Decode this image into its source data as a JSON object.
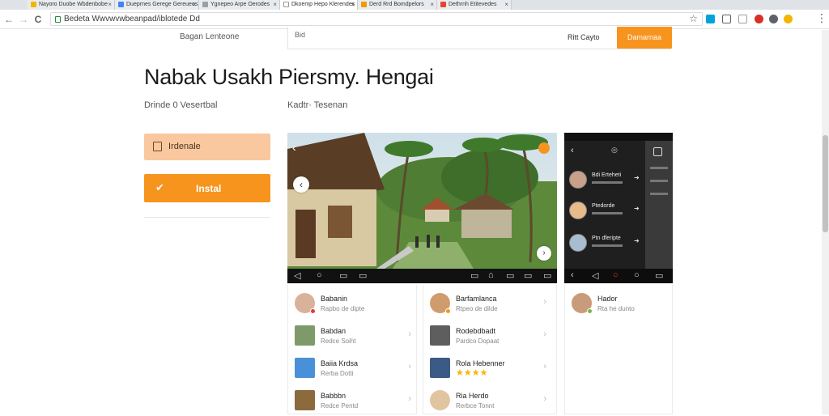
{
  "browser": {
    "tabs": [
      {
        "label": "Nayoro Duobe Wbdenbobe",
        "favicon_color": "#f4b400",
        "active": false
      },
      {
        "label": "Dueprnes Gerege Gereueos",
        "favicon_color": "#4285f4",
        "active": false
      },
      {
        "label": "Ygnepeo Arpe Oerodes",
        "favicon_color": "#9aa0a6",
        "active": false
      },
      {
        "label": "Dkoemp Hepo Klerendes",
        "favicon_color": "#ffffff",
        "active": true
      },
      {
        "label": "Derd Rrd Bomdpelors",
        "favicon_color": "#f29900",
        "active": false
      },
      {
        "label": "Dethrnh Etitevedes",
        "favicon_color": "#ea4335",
        "active": false
      }
    ],
    "url": "Bedeta Wwvwvwbeanpad/iblotede Dd",
    "nav": {
      "back": "←",
      "forward": "→",
      "reload": "C"
    },
    "star": "☆",
    "extensions": [
      {
        "name": "extension-icon-1",
        "color": "#00a4db"
      },
      {
        "name": "extension-icon-2",
        "color": "#5f6368"
      },
      {
        "name": "extension-icon-3",
        "color": "#9aa0a6"
      },
      {
        "name": "extension-icon-4",
        "color": "#d93025"
      },
      {
        "name": "extension-icon-5",
        "color": "#5f6368"
      },
      {
        "name": "extension-icon-6",
        "color": "#f4b400"
      }
    ],
    "menu": "⋮"
  },
  "header": {
    "nav_text": "Bagan Lenteone",
    "search_left": "Bid",
    "search_right": "Ritt  Cayto",
    "cta_label": "Damarnaa"
  },
  "app": {
    "title": "Nabak Usakh Piersmy. Hengai",
    "developer": "Drinde 0 Vesertbal",
    "category": "Kadtr·  Tesenan",
    "wishlist_label": "Irdenale",
    "install_label": "Instal",
    "install_icon": "✔"
  },
  "screenshots": {
    "phone_chats": [
      {
        "name": "Bdi Erteheti",
        "avatar": "#c9a089"
      },
      {
        "name": "Ptedorde",
        "avatar": "#e8b98a"
      },
      {
        "name": "Ptn dferipte",
        "avatar": "#a9bcd0"
      }
    ]
  },
  "related": {
    "col1": [
      {
        "name": "Babanin",
        "sub": "Rapbo de dipte",
        "thumb": "#d9b399",
        "round": true,
        "badge": "#e53935"
      },
      {
        "name": "Babdan",
        "sub": "Redce Soiht",
        "thumb": "#7f9a6a",
        "round": false,
        "badge": ""
      },
      {
        "name": "Baiia Krdsa",
        "sub": "Rerba Dotti",
        "thumb": "#4a90d9",
        "round": false,
        "badge": ""
      },
      {
        "name": "Babbbn",
        "sub": "Redce Pentd",
        "thumb": "#8b6a3e",
        "round": false,
        "badge": ""
      }
    ],
    "col2": [
      {
        "name": "Barfamlanca",
        "sub": "Rtpeo de dilde",
        "thumb": "#d19c6d",
        "round": true,
        "badge": "#f7941d"
      },
      {
        "name": "Rodebdbadt",
        "sub": "Pardco Dopaat",
        "thumb": "#5e5e5e",
        "round": false,
        "badge": ""
      },
      {
        "name": "Rola Hebenner",
        "sub": "",
        "stars": "★★★★",
        "thumb": "#3b5a86",
        "round": false,
        "badge": ""
      },
      {
        "name": "Ria Herdo",
        "sub": "Rerbce Tonnt",
        "thumb": "#e0c5a0",
        "round": true,
        "badge": ""
      }
    ],
    "col3": [
      {
        "name": "Hador",
        "sub": "Rta he dunto",
        "thumb": "#c89b7b",
        "round": true,
        "badge": "#7cb342"
      }
    ]
  }
}
